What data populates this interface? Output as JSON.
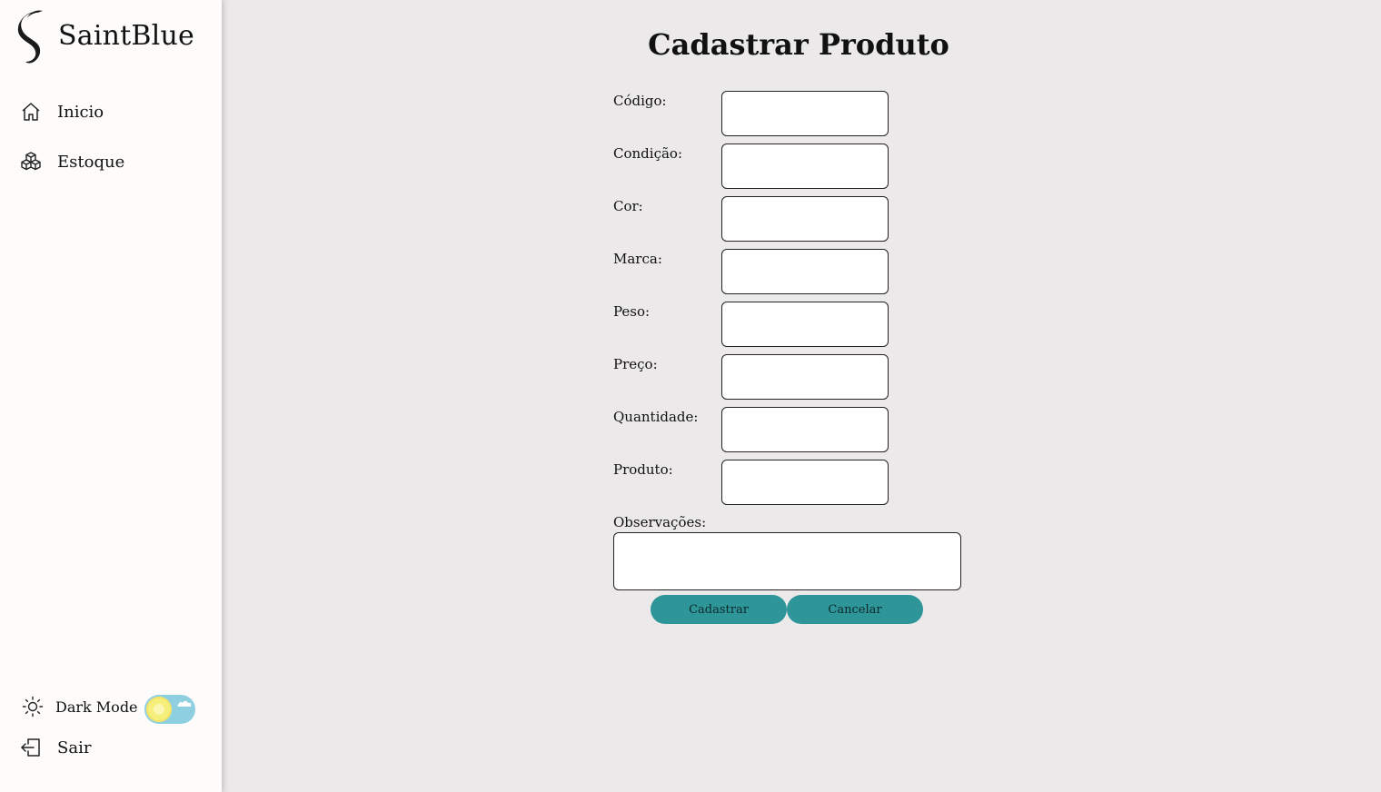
{
  "app": {
    "brand_name": "SaintBlue"
  },
  "sidebar": {
    "items": [
      {
        "label": "Inicio",
        "icon": "home-icon"
      },
      {
        "label": "Estoque",
        "icon": "boxes-icon"
      }
    ],
    "dark_mode": {
      "label": "Dark Mode",
      "enabled": false,
      "icon": "sun-icon"
    },
    "logout": {
      "label": "Sair",
      "icon": "logout-icon"
    }
  },
  "main": {
    "title": "Cadastrar Produto",
    "fields": [
      {
        "label": "Código:",
        "value": ""
      },
      {
        "label": "Condição:",
        "value": ""
      },
      {
        "label": "Cor:",
        "value": ""
      },
      {
        "label": "Marca:",
        "value": ""
      },
      {
        "label": "Peso:",
        "value": ""
      },
      {
        "label": "Preço:",
        "value": ""
      },
      {
        "label": "Quantidade:",
        "value": ""
      },
      {
        "label": "Produto:",
        "value": ""
      }
    ],
    "observacoes": {
      "label": "Observações:",
      "value": ""
    },
    "buttons": {
      "submit": "Cadastrar",
      "cancel": "Cancelar"
    }
  },
  "colors": {
    "accent": "#2e9599",
    "background": "#ebe9ea",
    "sidebar": "#fdfcfb",
    "toggle_track": "#8ecfe0",
    "toggle_knob": "#f6ef7b"
  }
}
